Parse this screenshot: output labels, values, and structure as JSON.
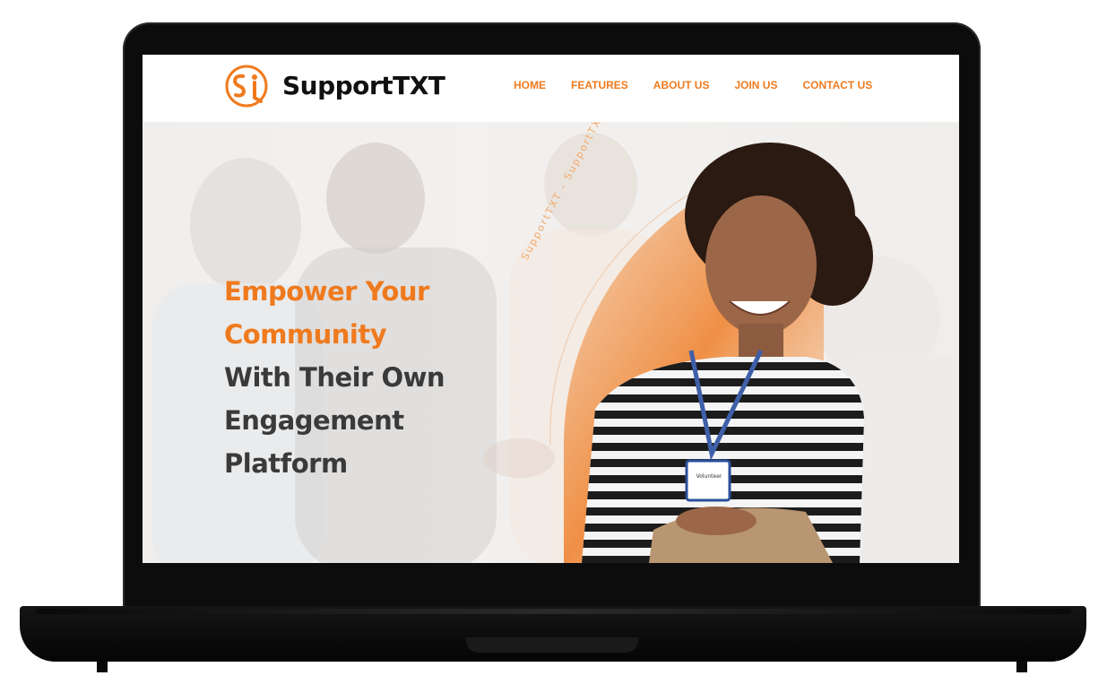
{
  "brand": {
    "name": "SupportTXT",
    "logo_letters": "St"
  },
  "nav": [
    {
      "label": "HOME"
    },
    {
      "label": "FEATURES"
    },
    {
      "label": "ABOUT US"
    },
    {
      "label": "JOIN US"
    },
    {
      "label": "CONTACT US"
    }
  ],
  "hero": {
    "headline_line1": "Empower Your",
    "headline_line2": "Community",
    "headline_line3": "With Their Own",
    "headline_line4": "Engagement",
    "headline_line5": "Platform",
    "arc_text": "SupportTXT - SupportTXT",
    "badge_text": "Volunteer"
  },
  "colors": {
    "accent": "#ef7a1e",
    "dark_text": "#3a3a3a",
    "laptop": "#0c0c0c"
  },
  "icons": [
    "supporttxt-logo-icon"
  ]
}
